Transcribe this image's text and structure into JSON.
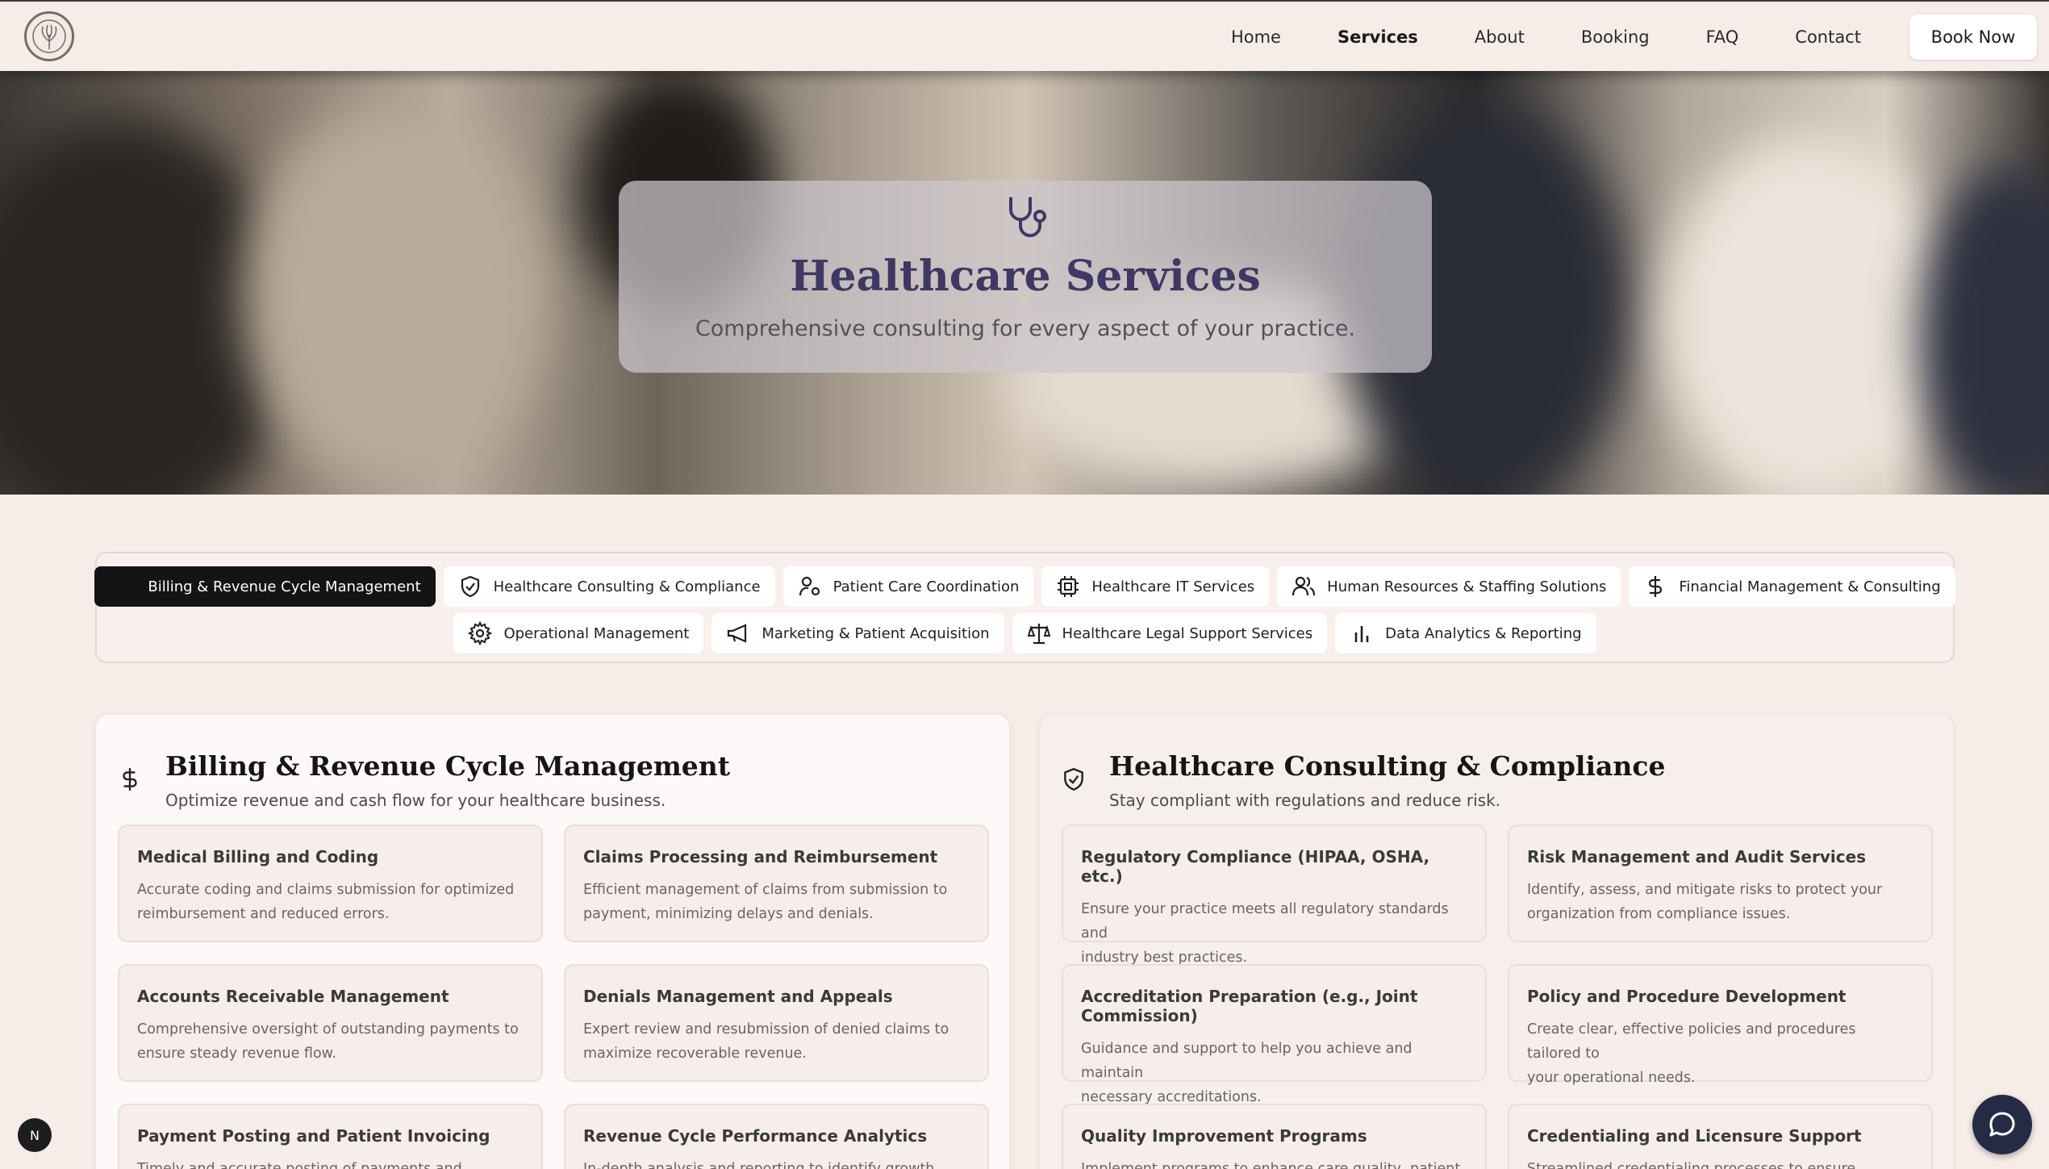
{
  "nav": {
    "links": [
      "Home",
      "Services",
      "About",
      "Booking",
      "FAQ",
      "Contact"
    ],
    "active": "Services",
    "cta": "Book Now"
  },
  "hero": {
    "icon": "stethoscope-icon",
    "title": "Healthcare Services",
    "subtitle": "Comprehensive consulting for every aspect of your practice."
  },
  "tabs": {
    "row1": [
      {
        "label": "Billing & Revenue Cycle Management",
        "icon": "dollar-icon",
        "active": true
      },
      {
        "label": "Healthcare Consulting & Compliance",
        "icon": "shield-check-icon"
      },
      {
        "label": "Patient Care Coordination",
        "icon": "user-cog-icon"
      },
      {
        "label": "Healthcare IT Services",
        "icon": "cpu-icon"
      },
      {
        "label": "Human Resources & Staffing Solutions",
        "icon": "users-icon"
      },
      {
        "label": "Financial Management & Consulting",
        "icon": "dollar-icon"
      }
    ],
    "row2": [
      {
        "label": "Operational Management",
        "icon": "gear-icon"
      },
      {
        "label": "Marketing & Patient Acquisition",
        "icon": "megaphone-icon"
      },
      {
        "label": "Healthcare Legal Support Services",
        "icon": "scale-icon"
      },
      {
        "label": "Data Analytics & Reporting",
        "icon": "bar-chart-icon"
      }
    ]
  },
  "sections": {
    "billing": {
      "title": "Billing & Revenue Cycle Management",
      "subtitle": "Optimize revenue and cash flow for your healthcare business.",
      "cards": [
        {
          "title": "Medical Billing and Coding",
          "desc1": "Accurate coding and claims submission for optimized",
          "desc2": "reimbursement and reduced errors."
        },
        {
          "title": "Claims Processing and Reimbursement",
          "desc1": "Efficient management of claims from submission to",
          "desc2": "payment, minimizing delays and denials."
        },
        {
          "title": "Accounts Receivable Management",
          "desc1": "Comprehensive oversight of outstanding payments to",
          "desc2": "ensure steady revenue flow."
        },
        {
          "title": "Denials Management and Appeals",
          "desc1": "Expert review and resubmission of denied claims to",
          "desc2": "maximize recoverable revenue."
        },
        {
          "title": "Payment Posting and Patient Invoicing",
          "desc1": "Timely and accurate posting of payments and generation of",
          "desc2": ""
        },
        {
          "title": "Revenue Cycle Performance Analytics",
          "desc1": "In-depth analysis and reporting to identify growth",
          "desc2": ""
        }
      ]
    },
    "compliance": {
      "title": "Healthcare Consulting & Compliance",
      "subtitle": "Stay compliant with regulations and reduce risk.",
      "cards": [
        {
          "title": "Regulatory Compliance (HIPAA, OSHA, etc.)",
          "desc1": "Ensure your practice meets all regulatory standards and",
          "desc2": "industry best practices."
        },
        {
          "title": "Risk Management and Audit Services",
          "desc1": "Identify, assess, and mitigate risks to protect your",
          "desc2": "organization from compliance issues."
        },
        {
          "title": "Accreditation Preparation (e.g., Joint Commission)",
          "desc1": "Guidance and support to help you achieve and maintain",
          "desc2": "necessary accreditations."
        },
        {
          "title": "Policy and Procedure Development",
          "desc1": "Create clear, effective policies and procedures tailored to",
          "desc2": "your operational needs."
        },
        {
          "title": "Quality Improvement Programs",
          "desc1": "Implement programs to enhance care quality, patient",
          "desc2": ""
        },
        {
          "title": "Credentialing and Licensure Support",
          "desc1": "Streamlined credentialing processes to ensure compliance",
          "desc2": ""
        }
      ]
    }
  },
  "floating": {
    "badge": "N",
    "chat_icon": "chat-icon"
  },
  "colors": {
    "accent": "#3f3862",
    "dark": "#141414",
    "background": "#f6ece8",
    "chat": "#262b45"
  }
}
